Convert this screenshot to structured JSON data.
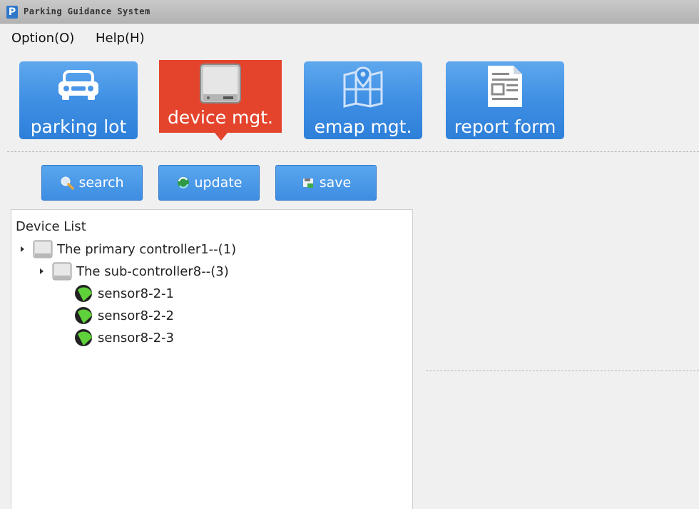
{
  "window": {
    "title": "Parking Guidance System",
    "logo_letter": "P"
  },
  "menu": [
    {
      "label": "Option(O)"
    },
    {
      "label": "Help(H)"
    }
  ],
  "nav_tiles": [
    {
      "label": "parking lot",
      "icon": "car-icon",
      "active": false
    },
    {
      "label": "device mgt.",
      "icon": "device-icon",
      "active": true
    },
    {
      "label": "emap mgt.",
      "icon": "map-icon",
      "active": false
    },
    {
      "label": "report form",
      "icon": "report-icon",
      "active": false
    }
  ],
  "toolbar": {
    "search_label": "search",
    "update_label": "update",
    "save_label": "save"
  },
  "tree": {
    "title": "Device List",
    "primary": "The primary controller1--(1)",
    "sub": "The sub-controller8--(3)",
    "sensors": [
      "sensor8-2-1",
      "sensor8-2-2",
      "sensor8-2-3"
    ]
  },
  "colors": {
    "tile_blue": "#3f8fe4",
    "tile_active_red": "#e4442c",
    "sensor_green": "#5fd13a"
  }
}
